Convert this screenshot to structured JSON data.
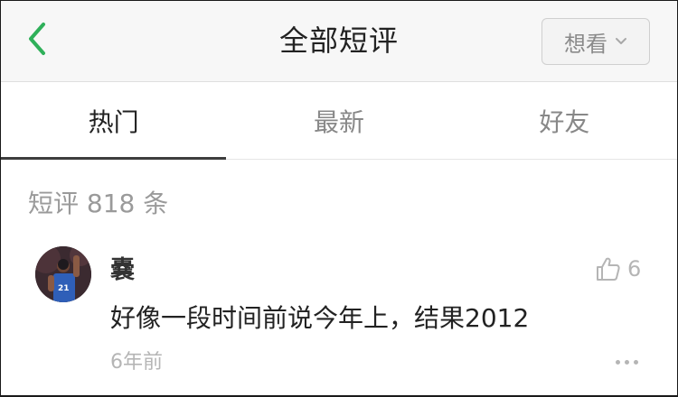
{
  "header": {
    "title": "全部短评",
    "want_label": "想看"
  },
  "tabs": [
    {
      "label": "热门",
      "active": true
    },
    {
      "label": "最新",
      "active": false
    },
    {
      "label": "好友",
      "active": false
    }
  ],
  "comments_count": "短评 818 条",
  "comment": {
    "username": "嚢",
    "text": "好像一段时间前说今年上，结果2012",
    "time": "6年前",
    "likes": "6",
    "avatar_jersey_number": "21"
  },
  "colors": {
    "back_arrow": "#2fb05a",
    "active_tab_underline": "#3d3d3d",
    "muted_text": "#9a9a9a"
  },
  "icons": {
    "back": "chevron-left-icon",
    "want_dropdown": "chevron-down-icon",
    "like": "thumbs-up-icon",
    "more": "more-dots-icon"
  }
}
